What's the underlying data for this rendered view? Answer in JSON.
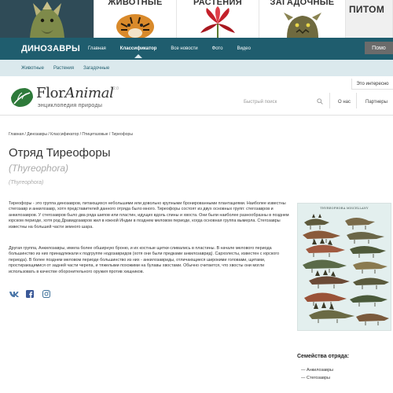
{
  "banner": {
    "tiles": [
      {
        "label": "",
        "art": "dinosaur-head"
      },
      {
        "label": "животные",
        "art": "tiger-head"
      },
      {
        "label": "растения",
        "art": "red-flower"
      },
      {
        "label": "загадочные",
        "art": "gargoyle-head"
      },
      {
        "label": "питом",
        "art": "none"
      }
    ]
  },
  "nav": {
    "brand": "ДИНОЗАВРЫ",
    "items": [
      "Главная",
      "Классификатор",
      "Все новости",
      "Фото",
      "Видео"
    ],
    "active_index": 1,
    "button": "Помо"
  },
  "subnav": {
    "items": [
      "Животные",
      "Растения",
      "Загадочные"
    ]
  },
  "header": {
    "logo_text_1": "Flor",
    "logo_text_2": "Animal",
    "logo_subtitle": "энциклопедия природы",
    "logo_version": "2.0",
    "search_placeholder": "Быстрый поиск",
    "links": [
      "О нас",
      "Партнеры"
    ],
    "interesting_tab": "Это интересно"
  },
  "breadcrumb": {
    "items": [
      "Главная",
      "Динозавры",
      "Классификатор",
      "Птицетазовые",
      "Тиреофоры"
    ],
    "separator": " / "
  },
  "article": {
    "title": "Отряд Тиреофоры",
    "latin": "(Thyreophora)",
    "latin_small": "(Thyreophora)",
    "paragraphs": [
      "Тиреофоры - это группа динозавров, питающихся небольшими или довольно крупными бронированными плантациями. Наиболее известны стегозавр и анкилозавр, хотя представителей данного отряда было много. Тиреофоры состоят из двух основных групп: стегозавров и анкилозавров. У стегозавров было два ряда шипов или пластин, идущих вдоль спины и хвоста. Они были наиболее разнообразны в позднем юрском периоде, хотя род Дравидозавров жил в южной Индии в позднем меловом периоде, когда основная группа вымерла. Стегозавры известны на большей части земного шара.",
      "Другая группа, Анкилозавры, имела более обширную броню, и их костные щитки сливались в пластины. В начале мелового периода большинство из них принадлежали к подгруппе нодозавридов (хотя они были предками анкилозаврид). Сархолесты, известен с юрского периода). В более позднем меловом периоде большинство из них - анкилозавриды, отличающиеся широкими головами, щитами, простирающимися от задней части черепа, и тяжелыми похожими на булавы хвостами. Обычно считается, что хвосты они могли использовать в качестве оборонительного оружия против хищников."
    ]
  },
  "share": {
    "icons": [
      "vk-icon",
      "facebook-icon",
      "instagram-icon"
    ]
  },
  "plate": {
    "title": "THYREOPHORA MISCELLANY"
  },
  "families": {
    "title": "Семейства отряда:",
    "items": [
      "— Анкилозавры",
      "— Стегозавры"
    ]
  },
  "colors": {
    "nav_bg": "#1f5d6e",
    "subnav_bg": "#dbe9ed",
    "banner_dark": "#2f4b57",
    "accent_link": "#1f5d6e"
  }
}
